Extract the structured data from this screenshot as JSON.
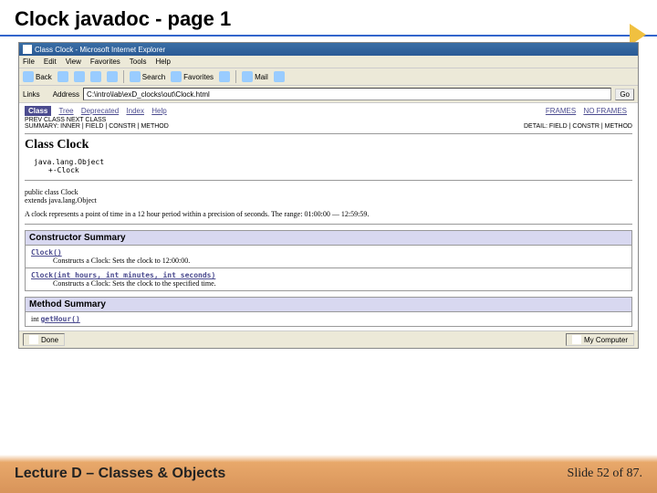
{
  "slide": {
    "title": "Clock javadoc - page 1",
    "lecture": "Lecture D – Classes & Objects",
    "slide_of": "Slide 52 of 87."
  },
  "browser": {
    "title": "Class Clock - Microsoft Internet Explorer",
    "menus": [
      "File",
      "Edit",
      "View",
      "Favorites",
      "Tools",
      "Help"
    ],
    "toolbar": {
      "back": "Back",
      "search": "Search",
      "favorites": "Favorites",
      "mail": "Mail"
    },
    "links_label": "Links",
    "address_label": "Address",
    "address_value": "C:\\intro\\lab\\exD_clocks\\out\\Clock.html",
    "go": "Go",
    "status_done": "Done",
    "status_zone": "My Computer"
  },
  "javadoc": {
    "nav": {
      "class": "Class",
      "tree": "Tree",
      "deprecated": "Deprecated",
      "index": "Index",
      "help": "Help",
      "frames": "FRAMES",
      "noframes": "NO FRAMES",
      "prev_next": "PREV CLASS   NEXT CLASS",
      "summary": "SUMMARY: INNER | FIELD | CONSTR | METHOD",
      "detail": "DETAIL: FIELD | CONSTR | METHOD"
    },
    "class_title": "Class Clock",
    "tree_parent": "java.lang.Object",
    "tree_self": "+-Clock",
    "declaration_1": "public class Clock",
    "declaration_2": "extends java.lang.Object",
    "description": "A clock represents a point of time in a 12 hour period within a precision of seconds. The range: 01:00:00 — 12:59:59.",
    "constructor_header": "Constructor Summary",
    "constructors": [
      {
        "sig": "Clock()",
        "desc": "Constructs a Clock: Sets the clock to 12:00:00."
      },
      {
        "sig": "Clock(int hours, int minutes, int seconds)",
        "desc": "Constructs a Clock: Sets the clock to the specified time."
      }
    ],
    "method_header": "Method Summary",
    "methods": [
      {
        "ret": "int",
        "sig": "getHour()"
      }
    ]
  }
}
